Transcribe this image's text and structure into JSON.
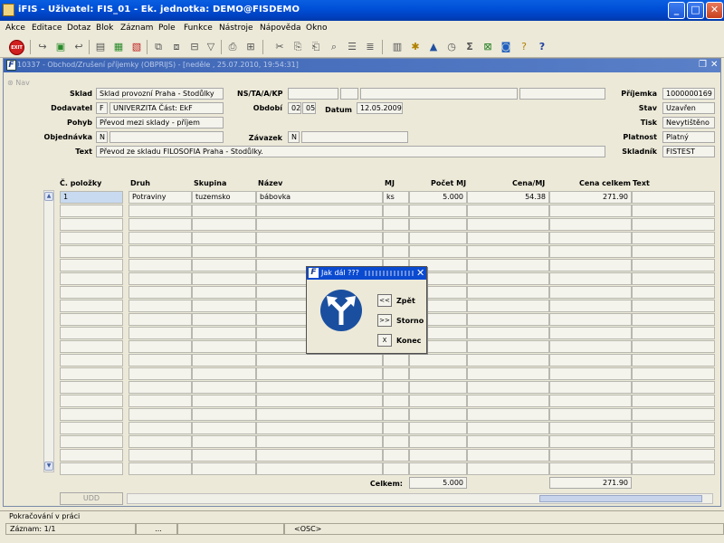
{
  "window": {
    "title": "iFIS - Uživatel: FIS_01 - Ek. jednotka: DEMO@FISDEMO"
  },
  "menu": [
    "Akce",
    "Editace",
    "Dotaz",
    "Blok",
    "Záznam",
    "Pole",
    "Funkce",
    "Nástroje",
    "Nápověda",
    "Okno"
  ],
  "toolbar": {
    "exit_label": "EXIT"
  },
  "child": {
    "title": "10337 - Obchod/Zrušení příjemky (OBPRIJS) - [neděle , 25.07.2010, 19:54:31]",
    "nav_label": "Nav"
  },
  "form": {
    "sklad": {
      "label": "Sklad",
      "value": "Sklad provozní Praha - Stodůlky"
    },
    "dodavatel": {
      "label": "Dodavatel",
      "code": "F",
      "value": "UNIVERZITA Část: EkF"
    },
    "pohyb": {
      "label": "Pohyb",
      "value": "Převod mezi sklady - příjem"
    },
    "objednavka": {
      "label": "Objednávka",
      "code": "N",
      "value": ""
    },
    "text": {
      "label": "Text",
      "value": "Převod ze skladu FILOSOFIA Praha - Stodůlky."
    },
    "nstakp": {
      "label": "NS/TA/A/KP"
    },
    "obdobi": {
      "label": "Období",
      "month": "02",
      "day": "05"
    },
    "datum": {
      "label": "Datum",
      "value": "12.05.2009"
    },
    "zavazek": {
      "label": "Závazek",
      "code": "N",
      "value": ""
    },
    "prijemka": {
      "label": "Příjemka",
      "value": "1000000169"
    },
    "stav": {
      "label": "Stav",
      "value": "Uzavřen"
    },
    "tisk": {
      "label": "Tisk",
      "value": "Nevytištěno"
    },
    "platnost": {
      "label": "Platnost",
      "value": "Platný"
    },
    "skladnik": {
      "label": "Skladník",
      "value": "FISTEST"
    }
  },
  "grid": {
    "headers": {
      "polozka": "Č. položky",
      "druh": "Druh",
      "skupina": "Skupina",
      "nazev": "Název",
      "mj": "MJ",
      "pocet": "Počet MJ",
      "cena": "Cena/MJ",
      "celkem": "Cena celkem",
      "text": "Text"
    },
    "rows": [
      {
        "polozka": "1",
        "druh": "Potraviny",
        "skupina": "tuzemsko",
        "nazev": "bábovka",
        "mj": "ks",
        "pocet": "5.000",
        "cena": "54.38",
        "celkem": "271.90",
        "text": ""
      }
    ]
  },
  "totals": {
    "label": "Celkem:",
    "pocet": "5.000",
    "celkem": "271.90"
  },
  "udd_label": "UDD",
  "dialog": {
    "title": "Jak dál ???",
    "buttons": [
      {
        "key": "<<",
        "label": "Zpět"
      },
      {
        "key": ">>",
        "label": "Storno"
      },
      {
        "key": "X",
        "label": "Konec"
      }
    ]
  },
  "status": {
    "message": "Pokračování v práci",
    "record": "Záznam: 1/1",
    "ellipsis": "...",
    "osc": "<OSC>"
  }
}
